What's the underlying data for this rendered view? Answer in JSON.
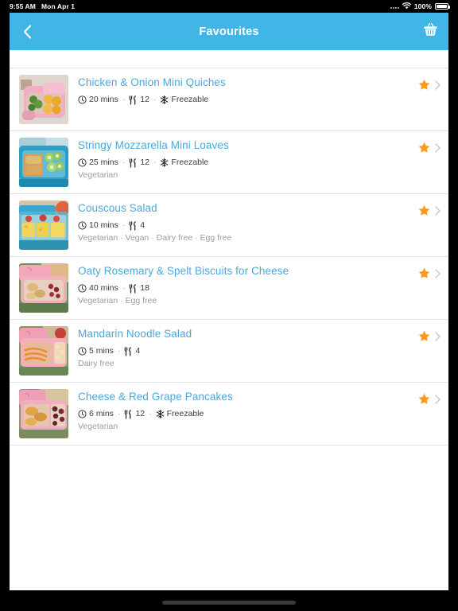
{
  "status_bar": {
    "time": "9:55 AM",
    "date": "Mon Apr 1",
    "battery_percent": "100%",
    "wifi_icon": "wifi-icon",
    "signal_icon": "signal-dots-icon",
    "battery_icon": "battery-icon"
  },
  "header": {
    "title": "Favourites",
    "back_icon": "chevron-left-icon",
    "basket_icon": "shopping-basket-icon",
    "background_color": "#41b6e6"
  },
  "colors": {
    "accent_blue": "#41b6e6",
    "link_blue": "#4aa8dd",
    "star_orange": "#f79c1b",
    "diet_grey": "#9d9d9d",
    "divider": "#e3e3e3"
  },
  "list": {
    "items": [
      {
        "title": "Chicken & Onion Mini Quiches",
        "time": "20 mins",
        "servings": "12",
        "freezable": "Freezable",
        "diet": "",
        "favourited": true,
        "thumb": {
          "box": "#f0aec0",
          "box_dark": "#dd8fa4",
          "bg": "#ded6cf",
          "food_a": "#5d9b3c",
          "food_b": "#f0b53c"
        }
      },
      {
        "title": "Stringy Mozzarella Mini Loaves",
        "time": "25 mins",
        "servings": "12",
        "freezable": "Freezable",
        "diet": "Vegetarian",
        "favourited": true,
        "thumb": {
          "box": "#2b9fc4",
          "box_dark": "#1b7f9f",
          "bg": "#a9cfdd",
          "food_a": "#d9a martin",
          "food_b": "#8dc06a"
        }
      },
      {
        "title": "Couscous Salad",
        "time": "10 mins",
        "servings": "4",
        "freezable": "",
        "diet": "Vegetarian · Vegan · Dairy free · Egg free",
        "favourited": true,
        "thumb": {
          "box": "#3aa8cc",
          "box_dark": "#2287a8",
          "bg": "#d7c3a8",
          "food_a": "#f2d45a",
          "food_b": "#d9453c"
        }
      },
      {
        "title": "Oaty Rosemary & Spelt Biscuits for Cheese",
        "time": "40 mins",
        "servings": "18",
        "freezable": "",
        "diet": "Vegetarian · Egg free",
        "favourited": true,
        "thumb": {
          "box": "#f2a7bb",
          "box_dark": "#dd889f",
          "bg": "#6f8f5a",
          "food_a": "#dcb87a",
          "food_b": "#9e2b3c"
        }
      },
      {
        "title": "Mandarin Noodle Salad",
        "time": "5 mins",
        "servings": "4",
        "freezable": "",
        "diet": "Dairy free",
        "favourited": true,
        "thumb": {
          "box": "#f0a0b4",
          "box_dark": "#d9869c",
          "bg": "#7d9a63",
          "food_a": "#ea8d33",
          "food_b": "#f4e3b0"
        }
      },
      {
        "title": "Cheese & Red Grape Pancakes",
        "time": "6 mins",
        "servings": "12",
        "freezable": "Freezable",
        "diet": "Vegetarian",
        "favourited": true,
        "thumb": {
          "box": "#eda0b6",
          "box_dark": "#d4879d",
          "bg": "#8a9c6a",
          "food_a": "#e0a44a",
          "food_b": "#6b2233"
        }
      }
    ],
    "icons": {
      "time_icon": "clock-icon",
      "servings_icon": "cutlery-icon",
      "freezable_icon": "snowflake-icon",
      "star_icon": "star-icon",
      "chevron_icon": "chevron-right-icon"
    },
    "separator": "·"
  }
}
